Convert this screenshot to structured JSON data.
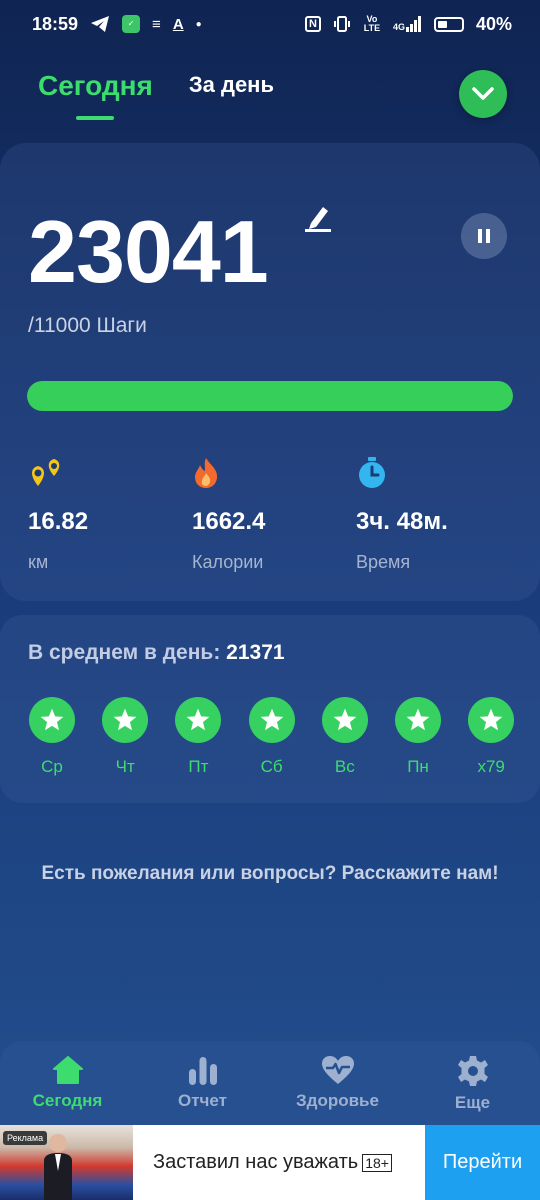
{
  "status_bar": {
    "time": "18:59",
    "icons_left": [
      "telegram-icon",
      "app-icon",
      "notes-icon",
      "text-icon",
      "dot-icon"
    ],
    "icons_right": [
      "nfc-icon",
      "vibrate-icon",
      "volte-icon",
      "signal-4g-icon",
      "battery-icon"
    ],
    "battery": "40%",
    "volte_label": "Vo LTE",
    "net_label": "4G"
  },
  "tabs": [
    {
      "label": "Сегодня",
      "active": true
    },
    {
      "label": "За день",
      "active": false
    }
  ],
  "main": {
    "steps": "23041",
    "goal_text": "/11000 Шаги",
    "progress_fraction": 1.0,
    "stats": [
      {
        "icon": "route-pin-icon",
        "value": "16.82",
        "label": "км"
      },
      {
        "icon": "flame-icon",
        "value": "1662.4",
        "label": "Калории"
      },
      {
        "icon": "stopwatch-icon",
        "value": "3ч. 48м.",
        "label": "Время"
      }
    ]
  },
  "average": {
    "label": "В среднем в день: ",
    "value": "21371",
    "days": [
      {
        "label": "Ср"
      },
      {
        "label": "Чт"
      },
      {
        "label": "Пт"
      },
      {
        "label": "Сб"
      },
      {
        "label": "Вс"
      },
      {
        "label": "Пн"
      },
      {
        "label": "x79"
      }
    ]
  },
  "feedback": "Есть пожелания или вопросы? Расскажите нам!",
  "nav": [
    {
      "icon": "home-icon",
      "label": "Сегодня",
      "active": true
    },
    {
      "icon": "bar-chart-icon",
      "label": "Отчет",
      "active": false
    },
    {
      "icon": "heart-pulse-icon",
      "label": "Здоровье",
      "active": false
    },
    {
      "icon": "gear-icon",
      "label": "Еще",
      "active": false
    }
  ],
  "ad": {
    "badge": "Реклама",
    "text": "Заставил нас уважать",
    "age": "18+",
    "button": "Перейти"
  },
  "colors": {
    "accent_green": "#3ddc6e",
    "bg_dark": "#0f2452",
    "ad_button": "#1ea0f0"
  }
}
